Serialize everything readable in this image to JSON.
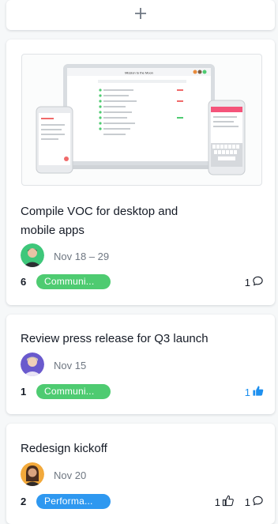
{
  "add_card": {
    "icon": "plus-icon"
  },
  "cards": [
    {
      "title_line1": "Compile VOC for desktop and",
      "title_line2": "mobile apps",
      "cover_window_title": "Mission to the Moon",
      "date": "Nov 18 – 29",
      "count": "6",
      "tag": "Communi...",
      "tag_color": "#4ecb71",
      "comments": "1",
      "comment_icon": "comment-icon"
    },
    {
      "title_line1": "Review press release for Q3 launch",
      "date": "Nov 15",
      "count": "1",
      "tag": "Communi...",
      "tag_color": "#4ecb71",
      "likes": "1",
      "like_icon": "thumbs-up-filled-icon",
      "like_color": "#1e90ef"
    },
    {
      "title_line1": "Redesign kickoff",
      "date": "Nov 20",
      "count": "2",
      "tag": "Performa...",
      "tag_color": "#2e98f0",
      "likes": "1",
      "like_icon": "thumbs-up-icon",
      "comments": "1",
      "comment_icon": "comment-icon"
    }
  ]
}
